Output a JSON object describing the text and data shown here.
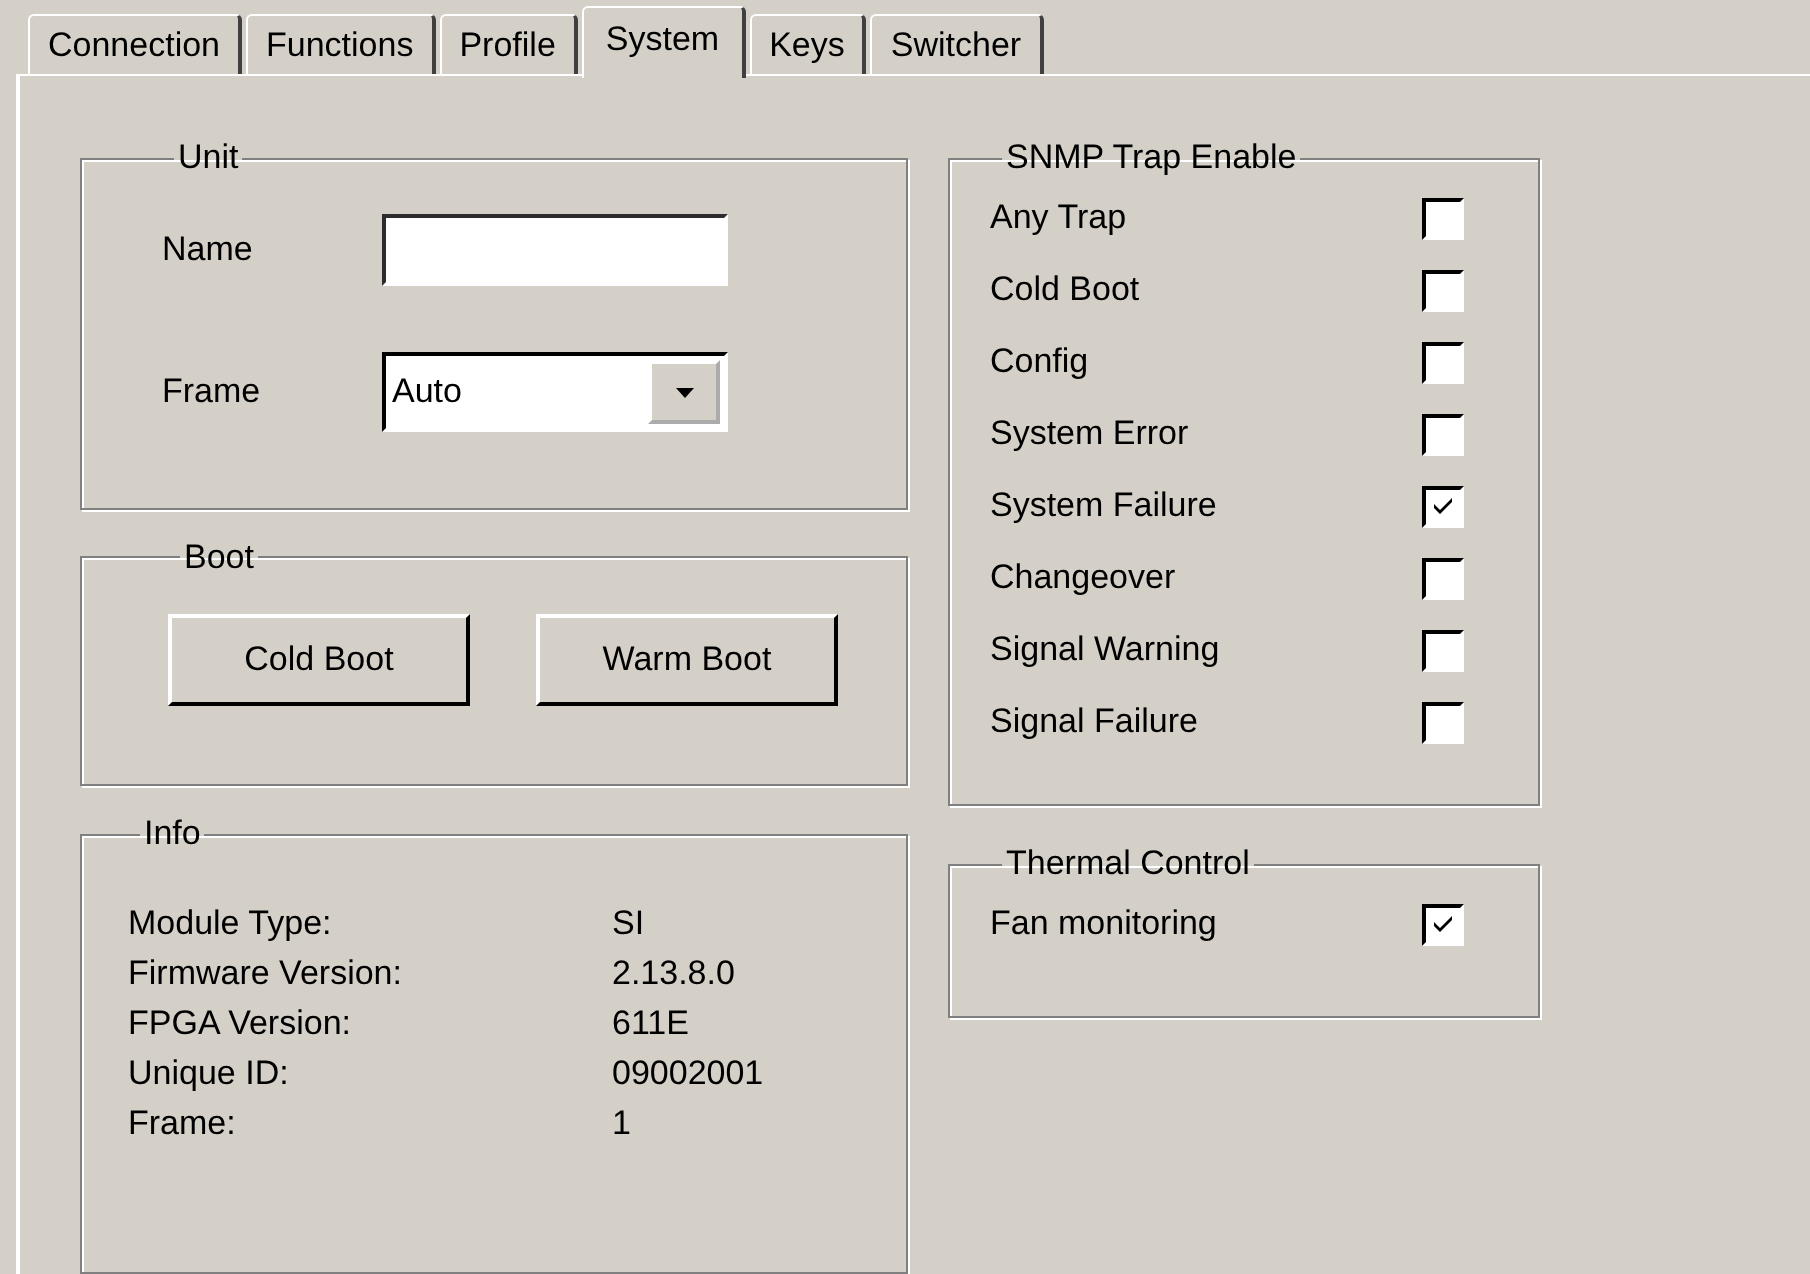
{
  "tabs": [
    {
      "label": "Connection",
      "selected": false
    },
    {
      "label": "Functions",
      "selected": false
    },
    {
      "label": "Profile",
      "selected": false
    },
    {
      "label": "System",
      "selected": true
    },
    {
      "label": "Keys",
      "selected": false
    },
    {
      "label": "Switcher",
      "selected": false
    }
  ],
  "unit": {
    "title": "Unit",
    "fields": [
      {
        "label": "Name",
        "kind": "text"
      },
      {
        "label": "Frame",
        "kind": "dropdown",
        "value": "Auto"
      }
    ]
  },
  "boot": {
    "title": "Boot",
    "buttons": [
      "Cold Boot",
      "Warm Boot"
    ]
  },
  "info": {
    "title": "Info",
    "rows": [
      {
        "label": "Module Type:",
        "value": "SI"
      },
      {
        "label": "Firmware Version:",
        "value": "2.13.8.0"
      },
      {
        "label": "FPGA Version:",
        "value": "611E"
      },
      {
        "label": "Unique ID:",
        "value": "09002001"
      },
      {
        "label": "Frame:",
        "value": "1"
      }
    ]
  },
  "snmp_trap_enable": {
    "title": "SNMP Trap Enable",
    "items": [
      {
        "label": "Any Trap",
        "checked": false
      },
      {
        "label": "Cold Boot",
        "checked": false
      },
      {
        "label": "Config",
        "checked": false
      },
      {
        "label": "System Error",
        "checked": false
      },
      {
        "label": "System Failure",
        "checked": true
      },
      {
        "label": "Changeover",
        "checked": false
      },
      {
        "label": "Signal Warning",
        "checked": false
      },
      {
        "label": "Signal Failure",
        "checked": false
      }
    ]
  },
  "thermal_control": {
    "title": "Thermal Control",
    "items": [
      {
        "label": "Fan  monitoring",
        "checked": true
      }
    ]
  }
}
